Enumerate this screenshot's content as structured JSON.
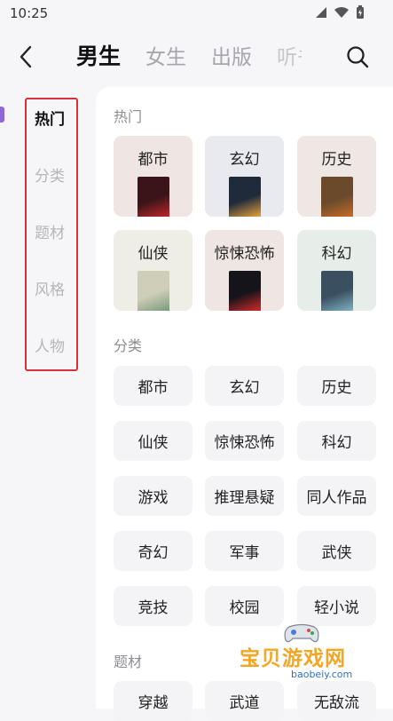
{
  "status_bar": {
    "time": "10:25"
  },
  "nav": {
    "tabs": [
      {
        "label": "男生",
        "active": true
      },
      {
        "label": "女生",
        "active": false
      },
      {
        "label": "出版",
        "active": false
      },
      {
        "label": "听书",
        "active": false
      }
    ]
  },
  "sidebar": {
    "items": [
      {
        "label": "热门",
        "active": true
      },
      {
        "label": "分类",
        "active": false
      },
      {
        "label": "题材",
        "active": false
      },
      {
        "label": "风格",
        "active": false
      },
      {
        "label": "人物",
        "active": false
      }
    ]
  },
  "hot": {
    "title": "热门",
    "cards": [
      {
        "label": "都市",
        "bg": "#efe6e4",
        "cover": "#3a1418",
        "cover_text": "财色人生",
        "cover_accent": "#c0262c"
      },
      {
        "label": "玄幻",
        "bg": "#e8eaef",
        "cover": "#1f2a3a",
        "cover_text": "小妖不乖",
        "cover_accent": "#e8a13a"
      },
      {
        "label": "历史",
        "bg": "#efe7e3",
        "cover": "#6b4a2c",
        "cover_text": "",
        "cover_accent": "#c86a2a"
      },
      {
        "label": "仙侠",
        "bg": "#eeeee6",
        "cover": "#cfcfb8",
        "cover_text": "太上仙帝",
        "cover_accent": "#7a9a7c"
      },
      {
        "label": "惊悚恐怖",
        "bg": "#efe6e4",
        "cover": "#15141a",
        "cover_text": "守灵人",
        "cover_accent": "#d22a2a"
      },
      {
        "label": "科幻",
        "bg": "#e7ede9",
        "cover": "#3a5060",
        "cover_text": "",
        "cover_accent": "#7fb2c4"
      }
    ]
  },
  "category": {
    "title": "分类",
    "items": [
      "都市",
      "玄幻",
      "历史",
      "仙侠",
      "惊悚恐怖",
      "科幻",
      "游戏",
      "推理悬疑",
      "同人作品",
      "奇幻",
      "军事",
      "武侠",
      "竞技",
      "校园",
      "轻小说"
    ]
  },
  "theme": {
    "title": "题材",
    "items": [
      "穿越",
      "武道",
      "无敌流"
    ]
  },
  "watermark": {
    "title": "宝贝游戏网",
    "url": "baobeiy.com"
  },
  "colors": {
    "accent": "#8f68d8",
    "highlight_box": "#d5333b",
    "watermark": "#f4a623"
  }
}
